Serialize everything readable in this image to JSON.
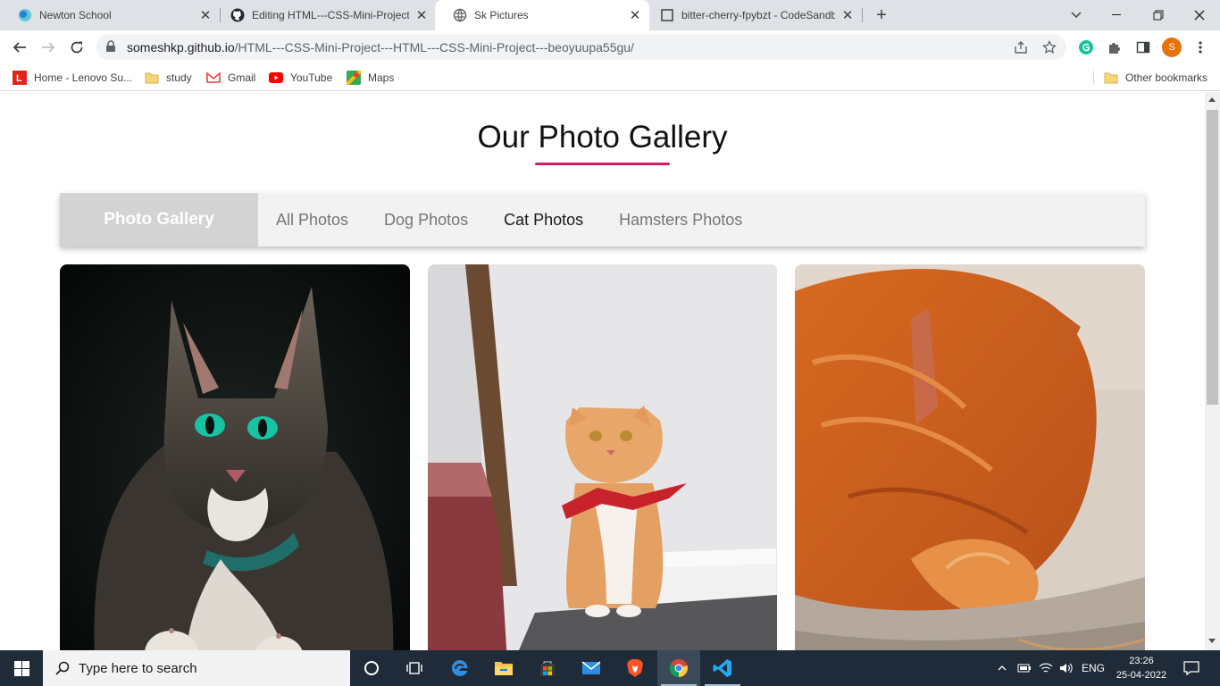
{
  "browser": {
    "tabs": [
      {
        "title": "Newton School",
        "icon": "newton-icon",
        "active": false
      },
      {
        "title": "Editing HTML---CSS-Mini-Project",
        "icon": "github-icon",
        "active": false
      },
      {
        "title": "Sk Pictures",
        "icon": "globe-icon",
        "active": true
      },
      {
        "title": "bitter-cherry-fpybzt - CodeSandbox",
        "icon": "codesandbox-icon",
        "active": false
      }
    ],
    "url_host": "someshkp.github.io",
    "url_path": "/HTML---CSS-Mini-Project---HTML---CSS-Mini-Project---beoyuupa55gu/",
    "profile_initial": "S",
    "bookmarks": [
      {
        "label": "Home - Lenovo Su...",
        "icon": "lenovo-icon"
      },
      {
        "label": "study",
        "icon": "folder-icon"
      },
      {
        "label": "Gmail",
        "icon": "gmail-icon"
      },
      {
        "label": "YouTube",
        "icon": "youtube-icon"
      },
      {
        "label": "Maps",
        "icon": "maps-icon"
      }
    ],
    "other_bookmarks": "Other bookmarks"
  },
  "page": {
    "heading": "Our Photo Gallery",
    "nav": {
      "brand": "Photo Gallery",
      "links": [
        "All Photos",
        "Dog Photos",
        "Cat Photos",
        "Hamsters Photos"
      ],
      "active": "Cat Photos"
    },
    "photos": [
      {
        "subject": "tabby cat with green eyes"
      },
      {
        "subject": "orange cat with red bandana"
      },
      {
        "subject": "orange cat covering face"
      }
    ]
  },
  "taskbar": {
    "search_placeholder": "Type here to search",
    "language": "ENG",
    "time": "23:26",
    "date": "25-04-2022"
  },
  "colors": {
    "accent_underline": "#d81b60",
    "nav_bg": "#f2f2f2",
    "brand_bg": "#d3d3d3"
  }
}
